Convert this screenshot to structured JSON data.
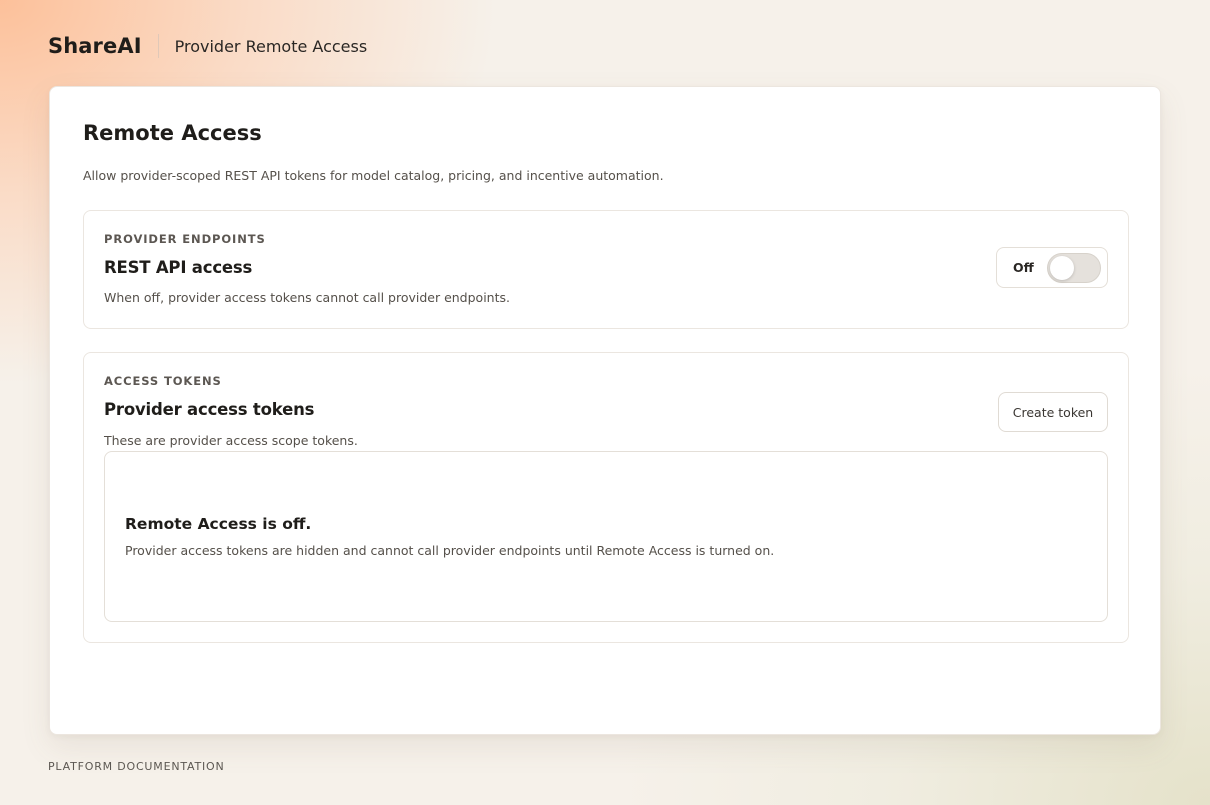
{
  "header": {
    "brand": "ShareAI",
    "subtitle": "Provider Remote Access"
  },
  "page": {
    "title": "Remote Access",
    "description": "Allow provider-scoped REST API tokens for model catalog, pricing, and incentive automation."
  },
  "endpoints": {
    "eyebrow": "PROVIDER ENDPOINTS",
    "title": "REST API access",
    "description": "When off, provider access tokens cannot call provider endpoints.",
    "toggle_label": "Off",
    "toggle_on": false
  },
  "tokens": {
    "eyebrow": "ACCESS TOKENS",
    "title": "Provider access tokens",
    "description": "These are provider access scope tokens.",
    "create_button": "Create token",
    "empty_title": "Remote Access is off.",
    "empty_description": "Provider access tokens are hidden and cannot call provider endpoints until Remote Access is turned on."
  },
  "footer": {
    "link": "PLATFORM DOCUMENTATION"
  }
}
